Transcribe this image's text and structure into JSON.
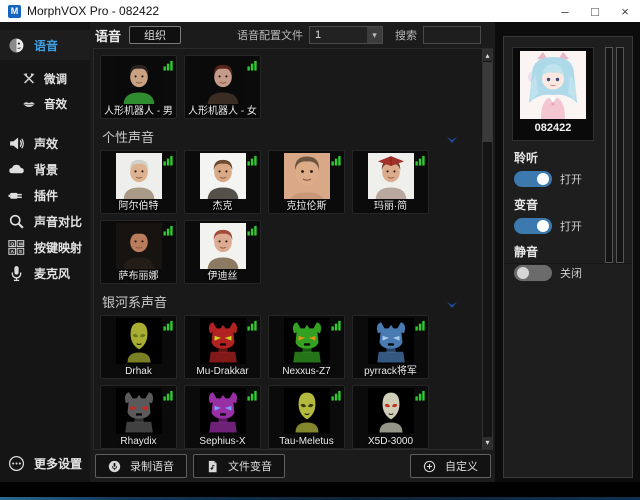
{
  "window": {
    "title": "MorphVOX Pro - 082422",
    "app_icon_letter": "M",
    "controls": {
      "minimize": "–",
      "maximize": "□",
      "close": "×"
    }
  },
  "sidebar": {
    "items": [
      {
        "key": "voice",
        "label": "语音",
        "icon": "voice-face-icon",
        "active": true,
        "sub": false
      },
      {
        "key": "finetune",
        "label": "微调",
        "icon": "tools-icon",
        "active": false,
        "sub": true
      },
      {
        "key": "soundfx",
        "label": "音效",
        "icon": "lips-icon",
        "active": false,
        "sub": true
      },
      {
        "key": "effects",
        "label": "声效",
        "icon": "speaker-icon",
        "active": false,
        "sub": false
      },
      {
        "key": "background",
        "label": "背景",
        "icon": "cloud-icon",
        "active": false,
        "sub": false
      },
      {
        "key": "plugins",
        "label": "插件",
        "icon": "plug-icon",
        "active": false,
        "sub": false
      },
      {
        "key": "compare",
        "label": "声音对比",
        "icon": "magnifier-icon",
        "active": false,
        "sub": false
      },
      {
        "key": "keymap",
        "label": "按键映射",
        "icon": "keyboard-icon",
        "active": false,
        "sub": false
      },
      {
        "key": "microphone",
        "label": "麦克风",
        "icon": "microphone-icon",
        "active": false,
        "sub": false
      }
    ],
    "footer": {
      "key": "more-settings",
      "label": "更多设置",
      "icon": "ellipsis-icon"
    }
  },
  "toolbar": {
    "title": "语音",
    "organize_label": "组织",
    "profile_label": "语音配置文件",
    "profile_value": "1",
    "search_label": "搜索",
    "search_value": ""
  },
  "voice_groups": [
    {
      "header": "",
      "voices": [
        {
          "name": "人形机器人 - 男",
          "avatar": {
            "kind": "person",
            "bg": "#0a0a0a",
            "skin": "#c9a183",
            "hair": "#2a2320",
            "shirt": "#2f8c2f"
          }
        },
        {
          "name": "人形机器人 - 女",
          "avatar": {
            "kind": "person",
            "bg": "#0a0a0a",
            "skin": "#c49a88",
            "hair": "#58241a",
            "shirt": "#3a2c22"
          }
        }
      ]
    },
    {
      "header": "个性声音",
      "voices": [
        {
          "name": "阿尔伯特",
          "avatar": {
            "kind": "person",
            "bg": "#eeeeec",
            "skin": "#dcb291",
            "hair": "#d0d0cc",
            "shirt": "#a89a86"
          }
        },
        {
          "name": "杰克",
          "avatar": {
            "kind": "person",
            "bg": "#f4f4f2",
            "skin": "#d9a987",
            "hair": "#6b4c32",
            "shirt": "#56504a"
          }
        },
        {
          "name": "克拉伦斯",
          "avatar": {
            "kind": "person",
            "bg": "#d9a887",
            "skin": "#dcab88",
            "hair": "#6e5540",
            "shirt": "#c89878",
            "closeup": true
          }
        },
        {
          "name": "玛丽·简",
          "avatar": {
            "kind": "person",
            "bg": "#efefec",
            "skin": "#dcab8c",
            "hair": "#6b4227",
            "shirt": "#b9a8a0",
            "prop": "#a23129"
          }
        },
        {
          "name": "萨布丽娜",
          "avatar": {
            "kind": "person",
            "bg": "#171310",
            "skin": "#b97c5c",
            "hair": "#171310",
            "shirt": "#241c16"
          }
        },
        {
          "name": "伊迪丝",
          "avatar": {
            "kind": "person",
            "bg": "#f2f2ef",
            "skin": "#dcab92",
            "hair": "#a34a38",
            "shirt": "#8d7a62"
          }
        }
      ]
    },
    {
      "header": "银河系声音",
      "voices": [
        {
          "name": "Drhak",
          "avatar": {
            "kind": "alien",
            "bg": "#000000",
            "head": "#a9ae32",
            "eyes": "#6c7a20"
          }
        },
        {
          "name": "Mu-Drakkar",
          "avatar": {
            "kind": "robot",
            "bg": "#000000",
            "head": "#b32222",
            "eyes": "#cadc22"
          }
        },
        {
          "name": "Nexxus-Z7",
          "avatar": {
            "kind": "robot",
            "bg": "#000000",
            "head": "#35a122",
            "eyes": "#e59312"
          }
        },
        {
          "name": "pyrrack将军",
          "avatar": {
            "kind": "robot",
            "bg": "#000000",
            "head": "#4a7ab2",
            "eyes": "#a9cdf0"
          }
        },
        {
          "name": "Rhaydix",
          "avatar": {
            "kind": "robot",
            "bg": "#000000",
            "head": "#5a5a5a",
            "eyes": "#d22222"
          }
        },
        {
          "name": "Sephius-X",
          "avatar": {
            "kind": "robot",
            "bg": "#000000",
            "head": "#992fa5",
            "eyes": "#7aa2ff"
          }
        },
        {
          "name": "Tau-Meletus",
          "avatar": {
            "kind": "alien",
            "bg": "#000000",
            "head": "#b4ba3e",
            "eyes": "#3a3a10"
          }
        },
        {
          "name": "X5D-3000",
          "avatar": {
            "kind": "alien",
            "bg": "#000000",
            "head": "#cfcfb8",
            "eyes": "#c23220"
          }
        }
      ]
    }
  ],
  "footer_buttons": {
    "record": {
      "label": "录制语音",
      "icon": "record-icon"
    },
    "file": {
      "label": "文件变音",
      "icon": "file-icon"
    },
    "custom": {
      "label": "自定义",
      "icon": "plus-circle-icon"
    }
  },
  "right_panel": {
    "profile_name": "082422",
    "meter_count": 2,
    "toggles": [
      {
        "key": "listen",
        "label": "聆听",
        "state": "打开",
        "on": true
      },
      {
        "key": "morph",
        "label": "变音",
        "state": "打开",
        "on": true
      },
      {
        "key": "mute",
        "label": "静音",
        "state": "关闭",
        "on": false
      }
    ]
  },
  "colors": {
    "accent_blue": "#3f9fe0",
    "toggle_on": "#3c79ae",
    "chevron_blue": "#1d4fa0",
    "audio_green": "#2fcc2f",
    "titlebar_icon": "#1565c0"
  }
}
